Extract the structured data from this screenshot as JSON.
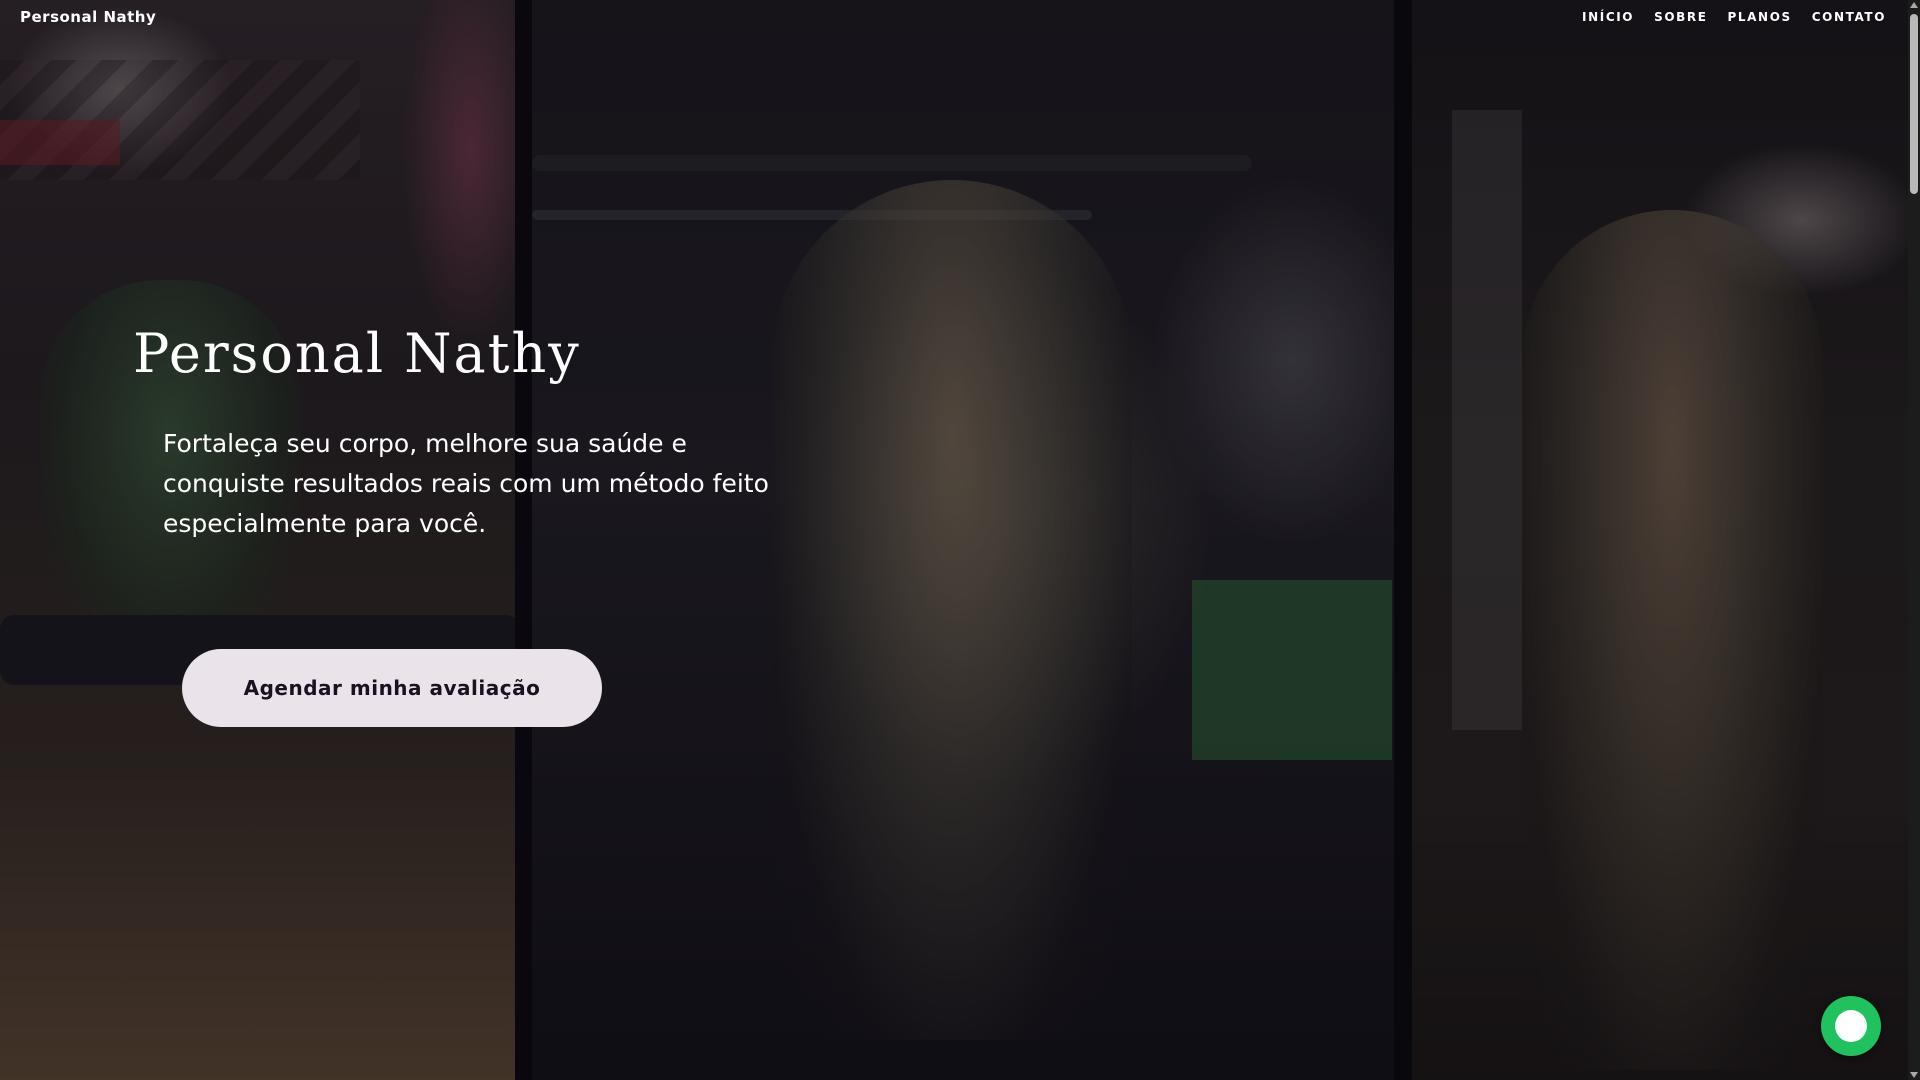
{
  "header": {
    "brand": "Personal Nathy",
    "nav": [
      {
        "label": "INÍCIO"
      },
      {
        "label": "SOBRE"
      },
      {
        "label": "PLANOS"
      },
      {
        "label": "CONTATO"
      }
    ]
  },
  "hero": {
    "title": "Personal Nathy",
    "subtitle": "Fortaleça seu corpo, melhore sua saúde e conquiste resultados reais com um método feito especialmente para você.",
    "cta_label": "Agendar minha avaliação"
  },
  "floating": {
    "chat_icon": "whatsapp-icon",
    "chat_color": "#20c25d"
  },
  "colors": {
    "cta_background": "#eae3ea",
    "cta_text": "#1a1220"
  }
}
